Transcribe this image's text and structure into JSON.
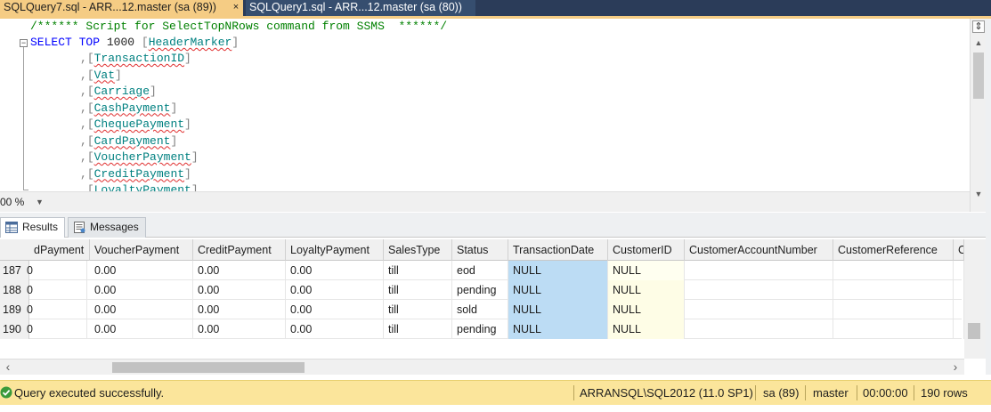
{
  "tabs": {
    "active": "SQLQuery7.sql - ARR...12.master (sa (89))",
    "active_close": "×",
    "inactive": "SQLQuery1.sql - ARR...12.master (sa (80))"
  },
  "editor": {
    "comment": "/****** Script for SelectTopNRows command from SSMS  ******/",
    "select_kw": "SELECT",
    "top_kw": "TOP",
    "top_value": "1000",
    "first_column": "HeaderMarker",
    "columns": [
      "TransactionID",
      "Vat",
      "Carriage",
      "CashPayment",
      "ChequePayment",
      "CardPayment",
      "VoucherPayment",
      "CreditPayment",
      "LoyaltyPayment"
    ],
    "collapse_symbol": "−"
  },
  "zoom": {
    "value": "00 %"
  },
  "results": {
    "tab_results": "Results",
    "tab_messages": "Messages",
    "headers": [
      "dPayment",
      "VoucherPayment",
      "CreditPayment",
      "LoyaltyPayment",
      "SalesType",
      "Status",
      "TransactionDate",
      "CustomerID",
      "CustomerAccountNumber",
      "CustomerReference",
      "C"
    ],
    "rows": [
      {
        "num": "187",
        "cells": [
          "0",
          "0.00",
          "0.00",
          "0.00",
          "till",
          "eod",
          "NULL",
          "NULL",
          "",
          "",
          ""
        ]
      },
      {
        "num": "188",
        "cells": [
          "0",
          "0.00",
          "0.00",
          "0.00",
          "till",
          "pending",
          "NULL",
          "NULL",
          "",
          "",
          ""
        ]
      },
      {
        "num": "189",
        "cells": [
          "0",
          "0.00",
          "0.00",
          "0.00",
          "till",
          "sold",
          "NULL",
          "NULL",
          "",
          "",
          ""
        ]
      },
      {
        "num": "190",
        "cells": [
          "0",
          "0.00",
          "0.00",
          "0.00",
          "till",
          "pending",
          "NULL",
          "NULL",
          "",
          "",
          ""
        ]
      }
    ]
  },
  "status": {
    "message": "Query executed successfully.",
    "server": "ARRANSQL\\SQL2012 (11.0 SP1)",
    "user": "sa (89)",
    "database": "master",
    "elapsed": "00:00:00",
    "rows": "190 rows"
  },
  "colors": {
    "tab_active": "#f5cc84",
    "status_bar": "#fbe59b",
    "null_highlight": "#bcdcf4",
    "keyword": "#0000ff",
    "comment": "#008000",
    "identifier": "#008080"
  },
  "icons": {
    "results_tab": "grid-icon",
    "messages_tab": "message-icon",
    "status": "success-check-icon"
  }
}
